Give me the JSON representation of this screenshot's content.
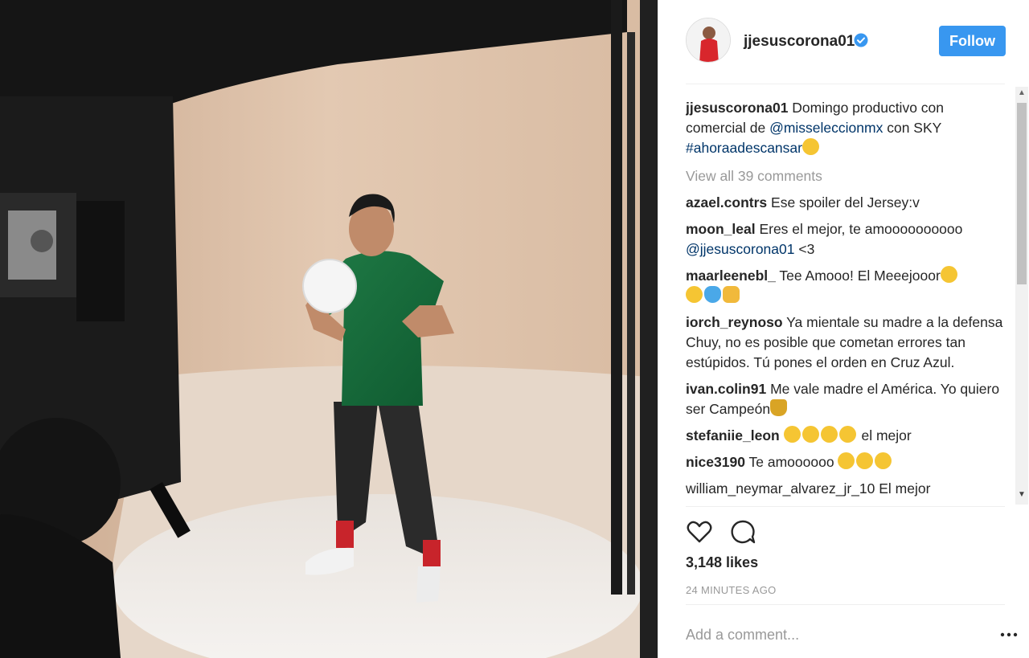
{
  "post": {
    "photo_alt": "photo-studio-shoot",
    "username": "jjesuscorona01",
    "follow_label": "Follow",
    "caption": {
      "user": "jjesuscorona01",
      "text_1": " Domingo productivo con comercial de ",
      "mention": "@misseleccionmx",
      "text_2": " con SKY ",
      "hashtag": "#ahoraadescansar"
    },
    "view_all": "View all 39 comments",
    "comments": [
      {
        "user": "azael.contrs",
        "text": "Ese spoiler del Jersey:v"
      },
      {
        "user": "moon_leal",
        "text": "Eres el mejor, te amoooooooooo ",
        "mention": "@jjesuscorona01",
        "text_after": " <3"
      },
      {
        "user": "maarleenebl_",
        "text": "Tee Amooo! El Meeejooor"
      },
      {
        "user": "iorch_reynoso",
        "text": "Ya mientale su madre a la defensa Chuy, no es posible que cometan errores tan estúpidos. Tú pones el orden en Cruz Azul."
      },
      {
        "user": "ivan.colin91",
        "text": "Me vale madre el América. Yo quiero ser Campeón"
      },
      {
        "user": "stefaniie_leon",
        "text": " el mejor"
      },
      {
        "user": "nice3190",
        "text": "Te amoooooo "
      }
    ],
    "cut_comment": "william_neymar_alvarez_jr_10 El mejor",
    "likes": "3,148 likes",
    "timestamp": "24 MINUTES AGO",
    "add_comment_placeholder": "Add a comment..."
  },
  "colors": {
    "follow_blue": "#3897f0",
    "verified_blue": "#3897f0",
    "link_blue": "#003569",
    "muted_gray": "#999999"
  },
  "icons": [
    "verified-badge-icon",
    "heart-icon",
    "comment-bubble-icon",
    "more-options-icon",
    "heart-eyes-emoji",
    "blue-heart-emoji",
    "clap-emoji",
    "trophy-emoji",
    "sleepy-emoji"
  ]
}
